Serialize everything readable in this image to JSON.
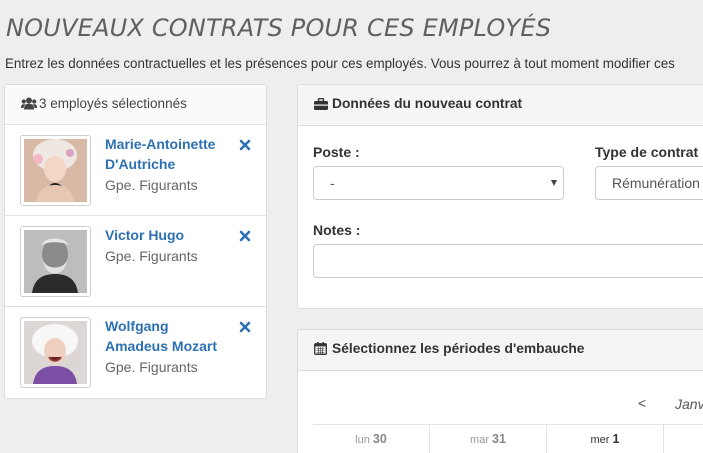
{
  "page": {
    "title": "NOUVEAUX CONTRATS POUR CES EMPLOYÉS",
    "intro": "Entrez les données contractuelles et les présences pour ces employés. Vous pourrez à tout moment modifier ces"
  },
  "employees_panel": {
    "header": "3 employés sélectionnés",
    "employees": [
      {
        "name": "Marie-Antoinette D'Autriche",
        "group": "Gpe. Figurants"
      },
      {
        "name": "Victor Hugo",
        "group": "Gpe. Figurants"
      },
      {
        "name": "Wolfgang Amadeus Mozart",
        "group": "Gpe. Figurants"
      }
    ]
  },
  "contract_panel": {
    "header": "Données du nouveau contrat",
    "poste_label": "Poste :",
    "poste_value": "-",
    "type_label": "Type de contrat :",
    "type_value": "Rémunération",
    "notes_label": "Notes :"
  },
  "calendar_panel": {
    "header": "Sélectionnez les périodes d'embauche",
    "prev": "<",
    "month": "Janvier",
    "days": [
      {
        "dow": "lun",
        "num": "30"
      },
      {
        "dow": "mar",
        "num": "31"
      },
      {
        "dow": "mer",
        "num": "1"
      }
    ]
  },
  "colors": {
    "link": "#2d71b3",
    "background": "#eeeeee"
  },
  "icons": [
    "users-icon",
    "remove-icon",
    "briefcase-icon",
    "calendar-icon"
  ]
}
